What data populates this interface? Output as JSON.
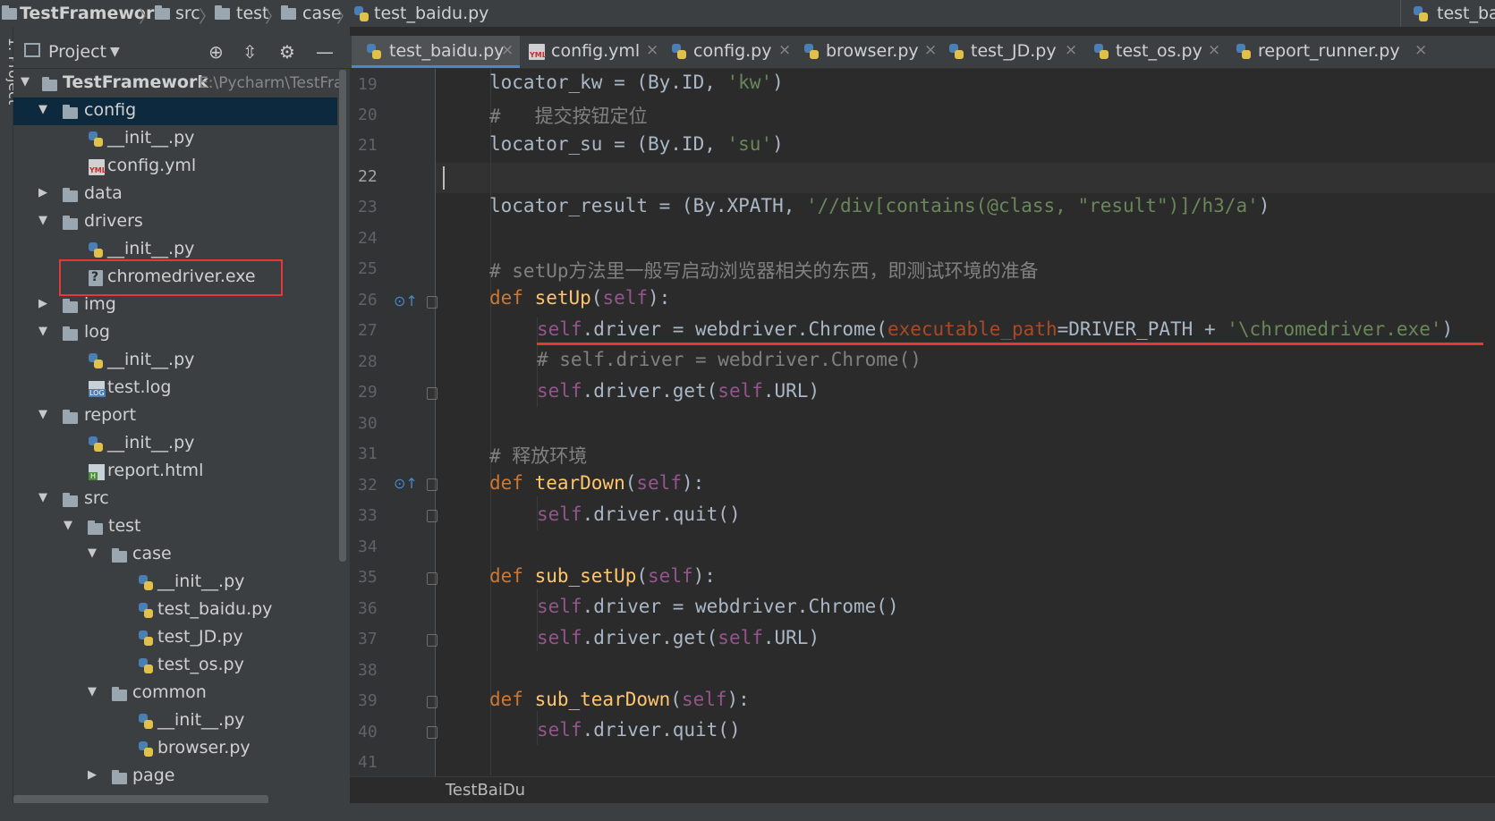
{
  "breadcrumb": {
    "project": "TestFramework",
    "items": [
      "src",
      "test",
      "case"
    ],
    "file": "test_baidu.py",
    "right_tab": "test_bai"
  },
  "sidebar_strip": {
    "label": "1: Project"
  },
  "project_panel": {
    "title": "Project",
    "root_name": "TestFramework",
    "root_path": "E:\\Pycharm\\TestFra",
    "tree": [
      {
        "label": "config"
      },
      {
        "label": "__init__.py"
      },
      {
        "label": "config.yml"
      },
      {
        "label": "data"
      },
      {
        "label": "drivers"
      },
      {
        "label": "__init__.py"
      },
      {
        "label": "chromedriver.exe"
      },
      {
        "label": "img"
      },
      {
        "label": "log"
      },
      {
        "label": "__init__.py"
      },
      {
        "label": "test.log"
      },
      {
        "label": "report"
      },
      {
        "label": "__init__.py"
      },
      {
        "label": "report.html"
      },
      {
        "label": "src"
      },
      {
        "label": "test"
      },
      {
        "label": "case"
      },
      {
        "label": "__init__.py"
      },
      {
        "label": "test_baidu.py"
      },
      {
        "label": "test_JD.py"
      },
      {
        "label": "test_os.py"
      },
      {
        "label": "common"
      },
      {
        "label": "__init__.py"
      },
      {
        "label": "browser.py"
      },
      {
        "label": "page"
      }
    ]
  },
  "tabs": [
    {
      "label": "test_baidu.py"
    },
    {
      "label": "config.yml"
    },
    {
      "label": "config.py"
    },
    {
      "label": "browser.py"
    },
    {
      "label": "test_JD.py"
    },
    {
      "label": "test_os.py"
    },
    {
      "label": "report_runner.py"
    }
  ],
  "tab_close": "×",
  "line_numbers": [
    "19",
    "20",
    "21",
    "22",
    "23",
    "24",
    "25",
    "26",
    "27",
    "28",
    "29",
    "30",
    "31",
    "32",
    "33",
    "34",
    "35",
    "36",
    "37",
    "38",
    "39",
    "40",
    "41"
  ],
  "code": {
    "l19": {
      "a": "locator_kw = (By.ID, ",
      "b": "'kw'",
      "c": ")"
    },
    "l20": "#   提交按钮定位",
    "l21": {
      "a": "locator_su = (By.ID, ",
      "b": "'su'",
      "c": ")"
    },
    "l23": {
      "a": "locator_result = (By.XPATH, ",
      "b": "'//div[contains(@class, \"result\")]/h3/a'",
      "c": ")"
    },
    "l25": "# setUp方法里一般写启动浏览器相关的东西，即测试环境的准备",
    "l26": {
      "kw": "def ",
      "fn": "setUp",
      "p1": "(",
      "self": "self",
      "p2": "):"
    },
    "l27": {
      "self": "self",
      "a": ".driver = webdriver.Chrome(",
      "param": "executable_path",
      "b": "=DRIVER_PATH + ",
      "str": "'\\chromedriver.exe'",
      "c": ")"
    },
    "l28": "# self.driver = webdriver.Chrome()",
    "l29": {
      "self1": "self",
      "a": ".driver.get(",
      "self2": "self",
      "b": ".URL)"
    },
    "l31": "# 释放环境",
    "l32": {
      "kw": "def ",
      "fn": "tearDown",
      "p1": "(",
      "self": "self",
      "p2": "):"
    },
    "l33": {
      "self": "self",
      "a": ".driver.quit()"
    },
    "l35": {
      "kw": "def ",
      "fn": "sub_setUp",
      "p1": "(",
      "self": "self",
      "p2": "):"
    },
    "l36": {
      "self": "self",
      "a": ".driver = webdriver.Chrome()"
    },
    "l37": {
      "self1": "self",
      "a": ".driver.get(",
      "self2": "self",
      "b": ".URL)"
    },
    "l39": {
      "kw": "def ",
      "fn": "sub_tearDown",
      "p1": "(",
      "self": "self",
      "p2": "):"
    },
    "l40": {
      "self": "self",
      "a": ".driver.quit()"
    }
  },
  "status": {
    "class_name": "TestBaiDu"
  },
  "colors": {
    "highlight_box": "#e53935",
    "selection": "#0d293e",
    "keyword": "#cc7832",
    "string": "#6a8759"
  }
}
